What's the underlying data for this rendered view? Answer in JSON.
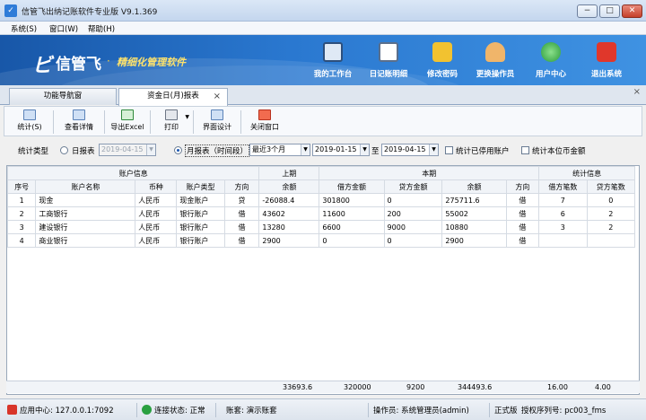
{
  "window": {
    "title": "信管飞出纳记账软件专业版 V9.1.369",
    "min": "−",
    "max": "□",
    "close": "✕"
  },
  "menu": [
    "系统(S)",
    "窗口(W)",
    "帮助(H)"
  ],
  "brand": {
    "mark": "ビ",
    "name": "信管飞",
    "dot": "·",
    "tagline": "精细化管理软件"
  },
  "header_buttons": [
    {
      "label": "我的工作台",
      "icon": "monitor-icon"
    },
    {
      "label": "日记账明细",
      "icon": "ledger-icon"
    },
    {
      "label": "修改密码",
      "icon": "lock-icon"
    },
    {
      "label": "更换操作员",
      "icon": "user-icon"
    },
    {
      "label": "用户中心",
      "icon": "globe-icon"
    },
    {
      "label": "退出系统",
      "icon": "power-icon"
    }
  ],
  "tabs": [
    {
      "label": "功能导航窗"
    },
    {
      "label": "资金日(月)报表",
      "close": "×"
    }
  ],
  "toolbar": [
    {
      "label": "统计(S)",
      "icon": "stats-icon"
    },
    {
      "label": "查看详情",
      "icon": "details-icon"
    },
    {
      "label": "导出Excel",
      "icon": "excel-icon"
    },
    {
      "label": "打印",
      "icon": "printer-icon"
    },
    {
      "label": "界面设计",
      "icon": "layout-icon"
    },
    {
      "label": "关闭窗口",
      "icon": "close-window-icon"
    }
  ],
  "filter": {
    "type_label": "统计类型",
    "daily_label": "日报表",
    "daily_date": "2019-04-15",
    "monthly_label": "月报表（时间段）",
    "period": "最近3个月",
    "from": "2019-01-15",
    "to_label": "至",
    "to": "2019-04-15",
    "include_disabled": "统计已停用账户",
    "base_currency": "统计本位币金额"
  },
  "table": {
    "groups": [
      "账户信息",
      "上期",
      "本期",
      "统计信息"
    ],
    "columns": [
      "序号",
      "账户名称",
      "币种",
      "账户类型",
      "方向",
      "余额",
      "借方金额",
      "贷方金额",
      "余额",
      "方向",
      "借方笔数",
      "贷方笔数"
    ],
    "rows": [
      [
        "1",
        "现金",
        "人民币",
        "现金账户",
        "贷",
        "-26088.4",
        "301800",
        "0",
        "275711.6",
        "借",
        "7",
        "0"
      ],
      [
        "2",
        "工商银行",
        "人民币",
        "银行账户",
        "借",
        "43602",
        "11600",
        "200",
        "55002",
        "借",
        "6",
        "2"
      ],
      [
        "3",
        "建设银行",
        "人民币",
        "银行账户",
        "借",
        "13280",
        "6600",
        "9000",
        "10880",
        "借",
        "3",
        "2"
      ],
      [
        "4",
        "商业银行",
        "人民币",
        "银行账户",
        "借",
        "2900",
        "0",
        "0",
        "2900",
        "借",
        "",
        ""
      ]
    ],
    "totals": {
      "prev_balance": "33693.6",
      "debit": "320000",
      "credit": "9200",
      "balance": "344493.6",
      "debit_count": "16.00",
      "credit_count": "4.00"
    }
  },
  "status": {
    "app_center": "应用中心: 127.0.0.1:7092",
    "connection": "连接状态: 正常",
    "books": "账套: 演示账套",
    "operator": "操作员: 系统管理员(admin)",
    "edition": "正式版",
    "serial": "授权序列号: pc003_fms"
  }
}
